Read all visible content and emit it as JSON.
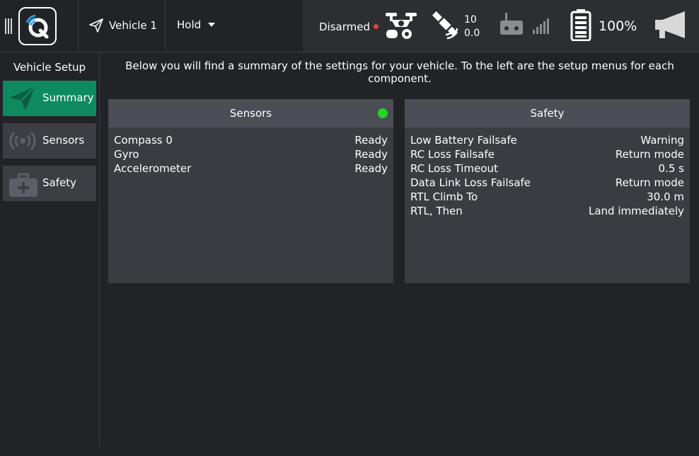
{
  "toolbar": {
    "vehicle_label": "Vehicle 1",
    "mode_label": "Hold",
    "arm_status": "Disarmed",
    "gps_satellites": "10",
    "gps_hdop": "0.0",
    "battery_percent": "100%"
  },
  "sidebar": {
    "title": "Vehicle Setup",
    "items": [
      {
        "label": "Summary",
        "icon": "paper-plane-icon"
      },
      {
        "label": "Sensors",
        "icon": "radio-waves-icon"
      },
      {
        "label": "Safety",
        "icon": "first-aid-kit-icon"
      }
    ]
  },
  "main": {
    "intro": "Below you will find a summary of the settings for your vehicle. To the left are the setup menus for each component.",
    "sensors": {
      "title": "Sensors",
      "rows": [
        {
          "name": "Compass 0",
          "value": "Ready"
        },
        {
          "name": "Gyro",
          "value": "Ready"
        },
        {
          "name": "Accelerometer",
          "value": "Ready"
        }
      ]
    },
    "safety": {
      "title": "Safety",
      "rows": [
        {
          "name": "Low Battery Failsafe",
          "value": "Warning"
        },
        {
          "name": "RC Loss Failsafe",
          "value": "Return mode"
        },
        {
          "name": "RC Loss Timeout",
          "value": "0.5 s"
        },
        {
          "name": "Data Link Loss Failsafe",
          "value": "Return mode"
        },
        {
          "name": "RTL Climb To",
          "value": "30.0 m"
        },
        {
          "name": "RTL, Then",
          "value": "Land immediately"
        }
      ]
    }
  },
  "colors": {
    "background": "#222326",
    "active": "#0f8a60",
    "status_ok": "#22d626",
    "disarmed_dot": "#e0433a"
  }
}
